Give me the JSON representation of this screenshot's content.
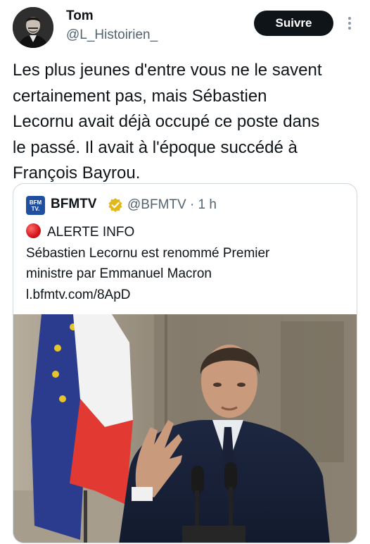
{
  "author": {
    "name": "Tom",
    "handle": "@L_Histoirien_",
    "avatar_icon": "avatar-portrait"
  },
  "follow_label": "Suivre",
  "tweet_lines": [
    "Les plus jeunes d'entre vous ne le savent",
    "certainement pas, mais Sébastien",
    "Lecornu avait déjà occupé ce poste dans",
    "le passé. Il avait à l'époque succédé à",
    "François Bayrou."
  ],
  "quote": {
    "logo_text": [
      "BFM",
      "TV."
    ],
    "name": "BFMTV",
    "handle_time": "@BFMTV · 1 h",
    "alert": "ALERTE INFO",
    "body_lines": [
      "Sébastien Lecornu est renommé Premier",
      "ministre par Emmanuel Macron"
    ],
    "link": "l.bfmtv.com/8ApD"
  },
  "colors": {
    "follow_bg": "#0f1419",
    "secondary_text": "#536471",
    "verified_gold": "#e2b719",
    "bfm_blue": "#1e4fa0",
    "alert_red": "#d4141a"
  }
}
